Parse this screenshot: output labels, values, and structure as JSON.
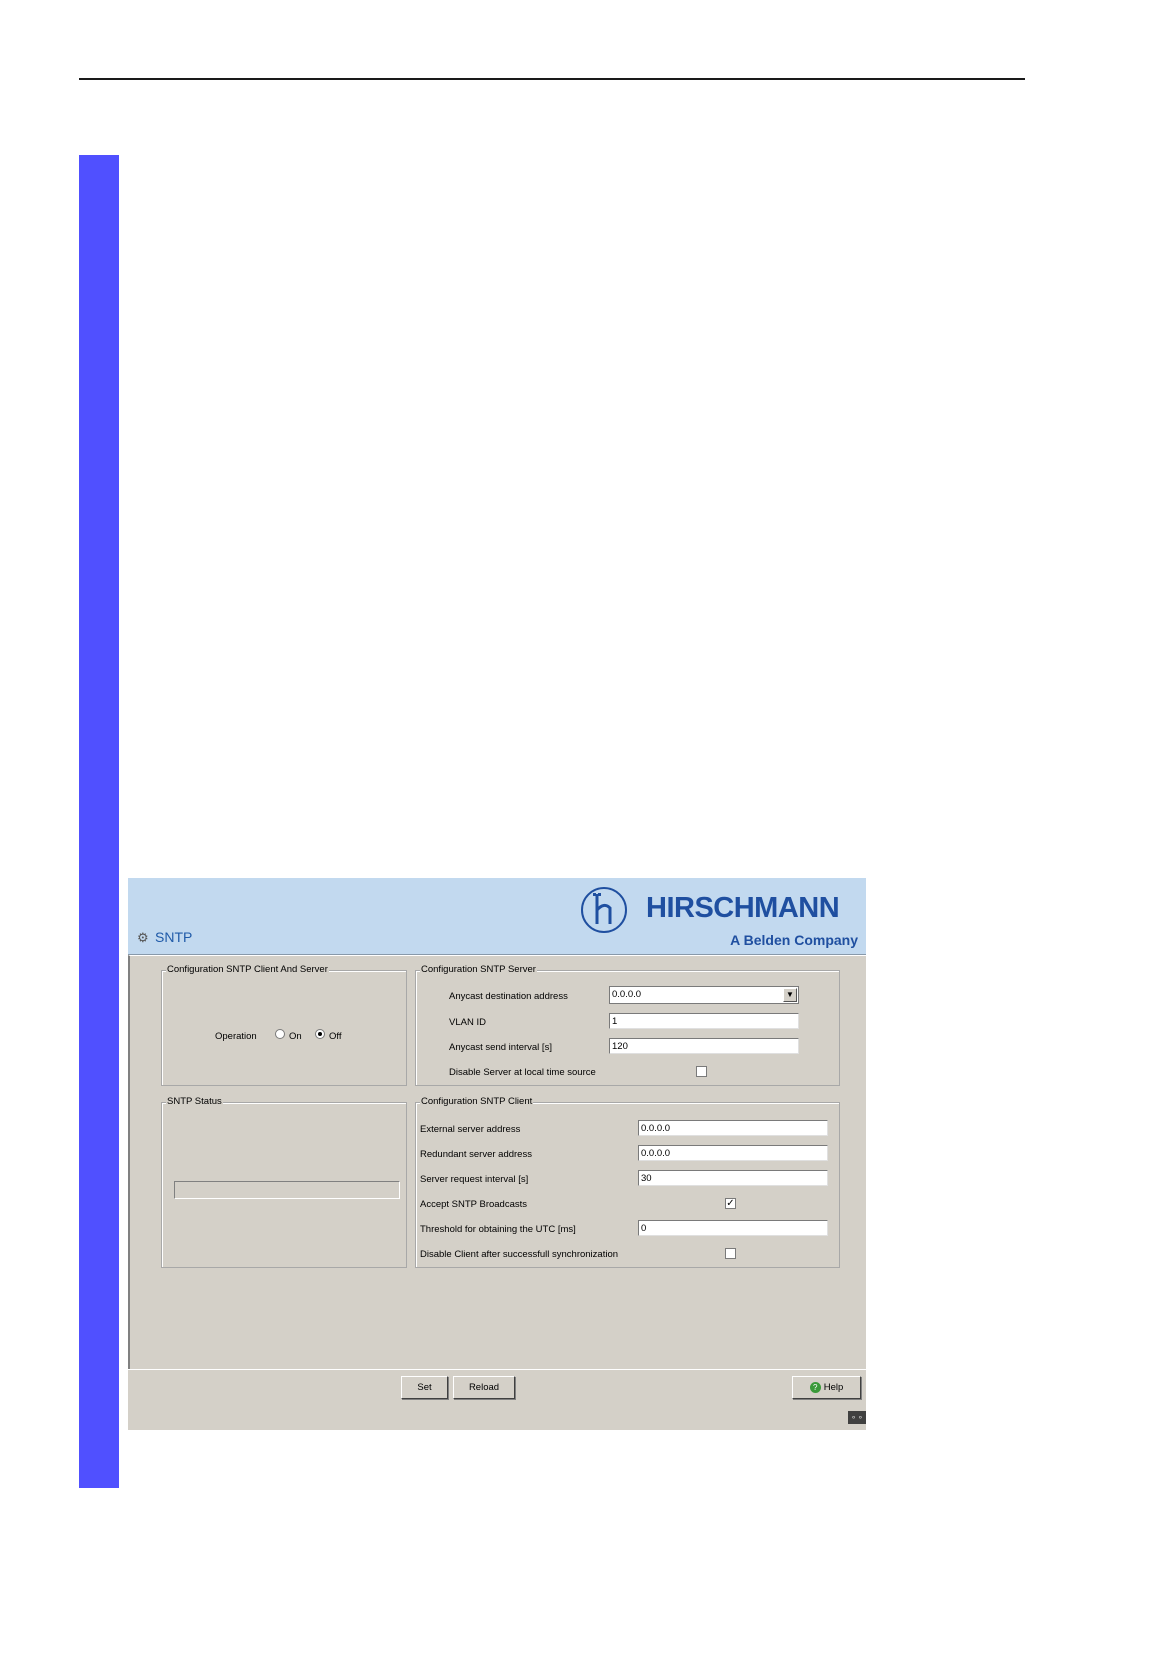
{
  "page": {
    "title": "SNTP",
    "brand_name": "HIRSCHMANN",
    "brand_tagline": "A Belden Company",
    "logo_letter": "h"
  },
  "groups": {
    "client_server": {
      "legend": "Configuration SNTP Client And Server",
      "operation_label": "Operation",
      "on_label": "On",
      "off_label": "Off",
      "selected": "Off"
    },
    "server": {
      "legend": "Configuration SNTP Server",
      "anycast_address_label": "Anycast destination address",
      "anycast_address_value": "0.0.0.0",
      "vlan_label": "VLAN ID",
      "vlan_value": "1",
      "interval_label": "Anycast send interval [s]",
      "interval_value": "120",
      "disable_label": "Disable Server at local time source",
      "disable_checked": false
    },
    "status": {
      "legend": "SNTP Status"
    },
    "client": {
      "legend": "Configuration SNTP Client",
      "external_label": "External server address",
      "external_value": "0.0.0.0",
      "redundant_label": "Redundant server address",
      "redundant_value": "0.0.0.0",
      "request_label": "Server request interval [s]",
      "request_value": "30",
      "broadcast_label": "Accept SNTP Broadcasts",
      "broadcast_checked": true,
      "threshold_label": "Threshold for obtaining the UTC [ms]",
      "threshold_value": "0",
      "disable_label": "Disable Client after successfull synchronization",
      "disable_checked": false
    }
  },
  "footer": {
    "set_label": "Set",
    "reload_label": "Reload",
    "help_label": "Help"
  },
  "icons": {
    "page_icon": "gear-icon",
    "help_icon": "help-circle-icon",
    "dropdown_icon": "chevron-down-icon"
  },
  "colors": {
    "side_bar": "#5050ff",
    "header_bg": "#c2d9ef",
    "brand": "#1f4fa0",
    "panel_bg": "#d4d0c8"
  }
}
